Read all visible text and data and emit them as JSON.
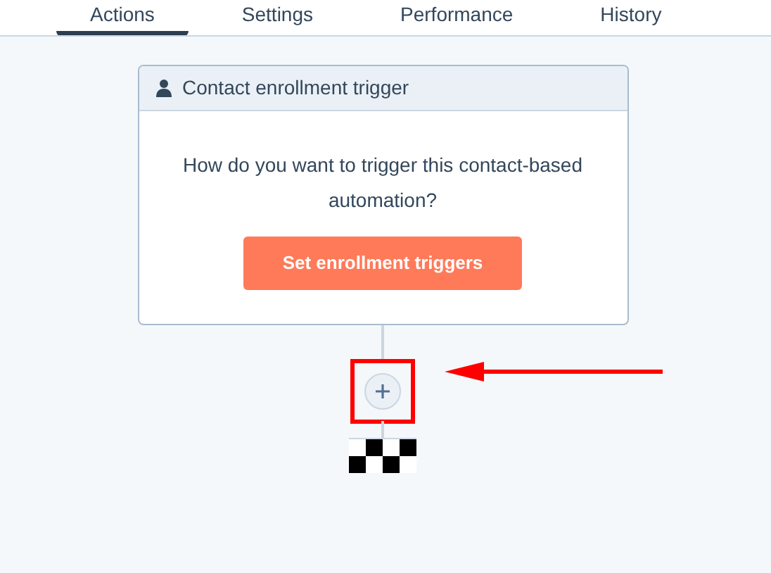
{
  "tabs": [
    {
      "label": "Actions",
      "selected": true
    },
    {
      "label": "Settings",
      "selected": false
    },
    {
      "label": "Performance",
      "selected": false
    },
    {
      "label": "History",
      "selected": false
    }
  ],
  "trigger_card": {
    "title": "Contact enrollment trigger",
    "prompt": "How do you want to trigger this contact-based automation?",
    "button": "Set enrollment triggers"
  },
  "add_action": {
    "highlighted": true
  }
}
